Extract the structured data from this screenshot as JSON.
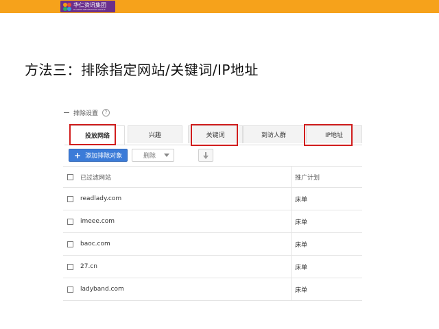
{
  "logo": {
    "name": "华仁资讯集团",
    "subtext": "HUAREN INFORMATION GROUP",
    "icon": "flower-logo-icon"
  },
  "slide_title": "方法三：排除指定网站/关键词/IP地址",
  "settings": {
    "label": "排除设置",
    "help_icon": "question-circle-icon",
    "collapse_icon": "minus-icon"
  },
  "tabs": [
    {
      "label": "投放网络",
      "active": true
    },
    {
      "label": "兴趣",
      "active": false
    },
    {
      "label": "关键词",
      "active": false
    },
    {
      "label": "到访人群",
      "active": false
    },
    {
      "label": "IP地址",
      "active": false
    }
  ],
  "highlight_color": "#d11d1d",
  "toolbar": {
    "add_label": "添加排除对象",
    "delete_label": "删除",
    "add_icon": "plus-icon",
    "download_icon": "down-arrow-icon",
    "accent_color": "#3b7bd8"
  },
  "table": {
    "headers": [
      "已过滤网站",
      "推广计划"
    ],
    "rows": [
      {
        "site": "readlady.com",
        "plan": "床单"
      },
      {
        "site": "imeee.com",
        "plan": "床单"
      },
      {
        "site": "baoc.com",
        "plan": "床单"
      },
      {
        "site": "27.cn",
        "plan": "床单"
      },
      {
        "site": "ladyband.com",
        "plan": "床单"
      }
    ]
  },
  "topbar_color": "#f6a21b"
}
